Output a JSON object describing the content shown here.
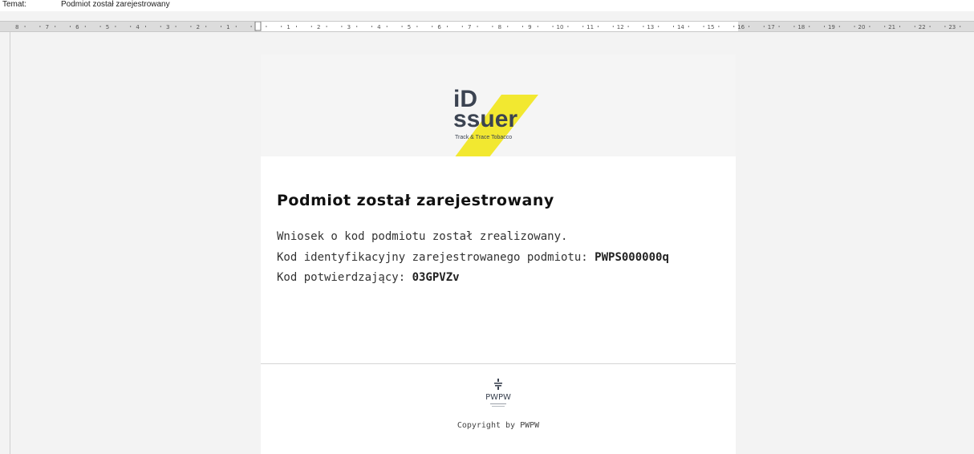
{
  "header": {
    "subject_label": "Temat:",
    "subject_value": "Podmiot został zarejestrowany"
  },
  "ruler": {
    "left_numbers": [
      "8",
      "7",
      "6",
      "5",
      "4",
      "3",
      "2",
      "1"
    ],
    "right_numbers": [
      "1",
      "2",
      "3",
      "4",
      "5",
      "6",
      "7",
      "8",
      "9",
      "10",
      "11",
      "12",
      "13",
      "14",
      "15",
      "16",
      "17",
      "18",
      "19",
      "20",
      "21",
      "22",
      "23"
    ]
  },
  "logo": {
    "brand_line1": "iD",
    "brand_line2": "ssuer",
    "tagline": "Track & Trace Tobacco",
    "accent_color": "#f2e830",
    "text_color": "#3b4351"
  },
  "message": {
    "title": "Podmiot został zarejestrowany",
    "line1": "Wniosek o kod podmiotu został zrealizowany.",
    "line2_label": "Kod identyfikacyjny zarejestrowanego podmiotu: ",
    "line2_value": "PWPS000000q",
    "line3_label": "Kod potwierdzający: ",
    "line3_value": "03GPVZv"
  },
  "footer": {
    "org_logo_text": "PWPW",
    "copyright": "Copyright by PWPW"
  }
}
